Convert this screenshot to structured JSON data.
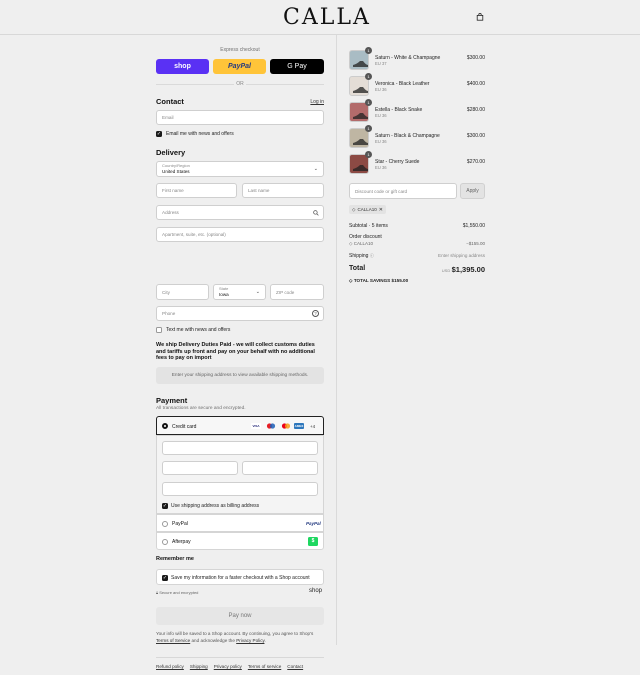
{
  "brand": {
    "logo": "CALLA"
  },
  "express": {
    "label": "Express checkout",
    "shop": "shop",
    "paypal": "PayPal",
    "gpay": "G Pay",
    "or": "OR"
  },
  "contact": {
    "title": "Contact",
    "login": "Log in",
    "email_placeholder": "Email",
    "news_label": "Email me with news and offers"
  },
  "delivery": {
    "title": "Delivery",
    "country_label": "Country/Region",
    "country_value": "United States",
    "first_name": "First name",
    "last_name": "Last name",
    "address": "Address",
    "apartment": "Apartment, suite, etc. (optional)",
    "city": "City",
    "state_label": "State",
    "state_value": "Iowa",
    "zip": "ZIP code",
    "phone": "Phone",
    "text_label": "Text me with news and offers",
    "notice": "We ship Delivery Duties Paid - we will collect customs duties and tariffs up front and pay on your behalf with no additional fees to pay on import",
    "shipping_msg": "Enter your shipping address to view available shipping methods."
  },
  "payment": {
    "title": "Payment",
    "subtitle": "All transactions are secure and encrypted.",
    "credit_card": "Credit card",
    "more_cards": "+4",
    "billing_label": "Use shipping address as billing address",
    "paypal": "PayPal",
    "paypal_logo": "PayPal",
    "afterpay": "Afterpay",
    "afterpay_logo": "$"
  },
  "remember": {
    "title": "Remember me",
    "save_label": "Save my information for a faster checkout with a Shop account",
    "secure": "Secure and encrypted",
    "shop": "shop"
  },
  "pay_button": "Pay now",
  "disclaimer": {
    "pre": "Your info will be saved to a Shop account. By continuing, you agree to Shop's",
    "terms": "Terms of Service",
    "mid": "and acknowledge the",
    "privacy": "Privacy Policy",
    "end": "."
  },
  "footer": [
    "Refund policy",
    "Shipping",
    "Privacy policy",
    "Terms of service",
    "Contact"
  ],
  "cart": {
    "items": [
      {
        "name": "Saturn - White & Champagne",
        "variant": "EU 37",
        "qty": "1",
        "price": "$300.00",
        "color": "#a9bcc4"
      },
      {
        "name": "Veronica - Black Leather",
        "variant": "EU 36",
        "qty": "1",
        "price": "$400.00",
        "color": "#e4ddd6"
      },
      {
        "name": "Estella - Black Snake",
        "variant": "EU 36",
        "qty": "1",
        "price": "$280.00",
        "color": "#b36b6b"
      },
      {
        "name": "Saturn - Black & Champagne",
        "variant": "EU 36",
        "qty": "1",
        "price": "$300.00",
        "color": "#bfb6a3"
      },
      {
        "name": "Star - Cherry Suede",
        "variant": "EU 36",
        "qty": "1",
        "price": "$270.00",
        "color": "#8c4a44"
      }
    ],
    "discount_placeholder": "Discount code or gift card",
    "apply": "Apply",
    "code": "CALLA10",
    "subtotal_label": "Subtotal · 5 items",
    "subtotal": "$1,550.00",
    "order_discount": "Order discount",
    "discount_code": "CALLA10",
    "discount_amount": "−$155.00",
    "shipping_label": "Shipping",
    "shipping_value": "Enter shipping address",
    "total_label": "Total",
    "currency": "USD",
    "total": "$1,395.00",
    "savings_label": "TOTAL SAVINGS",
    "savings": "$155.00"
  }
}
